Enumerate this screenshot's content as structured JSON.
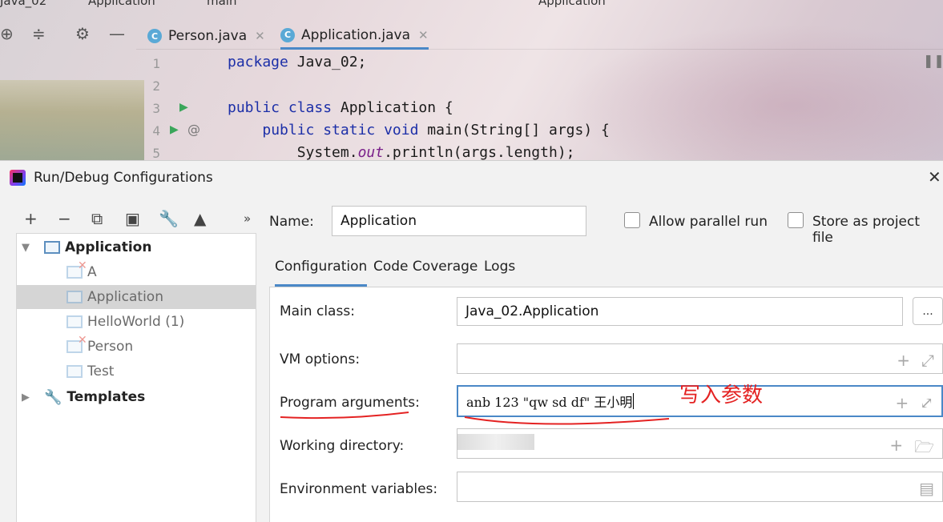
{
  "ide": {
    "project_name": "Java_02",
    "top_class": "Application",
    "top_method": "main",
    "run_config": "Application",
    "tabs": [
      {
        "label": "Person.java",
        "active": false
      },
      {
        "label": "Application.java",
        "active": true
      }
    ],
    "code_lines": [
      {
        "num": "1",
        "text": "package Java_02;"
      },
      {
        "num": "2",
        "text": ""
      },
      {
        "num": "3",
        "text": "public class Application {"
      },
      {
        "num": "4",
        "text": "    public static void main(String[] args) {"
      },
      {
        "num": "5",
        "text": "        System.out.println(args.length);"
      }
    ]
  },
  "dialog": {
    "title": "Run/Debug Configurations",
    "toolbar_icons": [
      "plus-icon",
      "minus-icon",
      "copy-icon",
      "save-icon",
      "wrench-icon",
      "move-up-icon",
      "more-icon"
    ],
    "tree": [
      {
        "label": "Application",
        "bold": true,
        "level": 0,
        "expanded": true
      },
      {
        "label": "A",
        "level": 1,
        "error": true
      },
      {
        "label": "Application",
        "level": 1,
        "selected": true
      },
      {
        "label": "HelloWorld (1)",
        "level": 1
      },
      {
        "label": "Person",
        "level": 1,
        "error": true
      },
      {
        "label": "Test",
        "level": 1
      },
      {
        "label": "Templates",
        "bold": true,
        "level": 0,
        "expanded": false
      }
    ],
    "name_label": "Name:",
    "name_value": "Application",
    "allow_parallel": "Allow parallel run",
    "store_as_file": "Store as project file",
    "config_tabs": [
      "Configuration",
      "Code Coverage",
      "Logs"
    ],
    "fields": {
      "main_class_label": "Main class:",
      "main_class_value": "Java_02.Application",
      "more_btn": "...",
      "vm_options_label": "VM options:",
      "vm_options_value": "",
      "program_args_label": "Program arguments:",
      "program_args_value": "anb 123 \"qw sd df\" 王小明",
      "working_dir_label": "Working directory:",
      "env_vars_label": "Environment variables:"
    },
    "annotation": "写入参数",
    "colors": {
      "accent": "#4a88c7",
      "annotation": "#e42222",
      "run_green": "#3aa65a"
    }
  }
}
